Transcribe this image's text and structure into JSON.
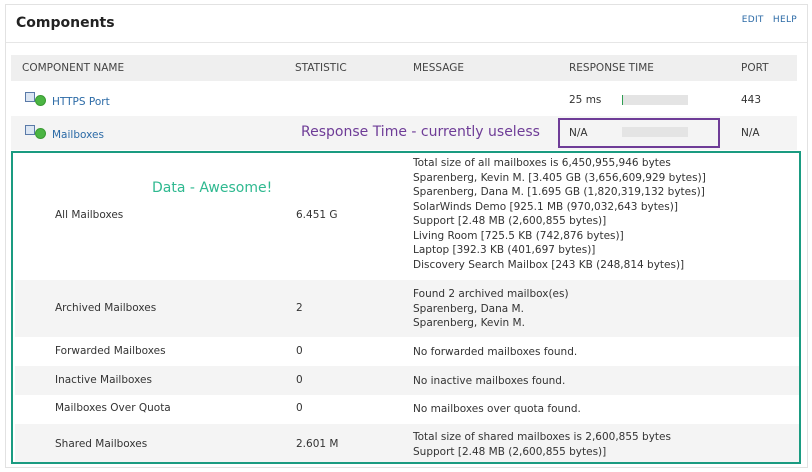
{
  "panel": {
    "title": "Components",
    "edit_label": "EDIT",
    "help_label": "HELP"
  },
  "columns": {
    "name": "COMPONENT NAME",
    "statistic": "STATISTIC",
    "message": "MESSAGE",
    "response_time": "RESPONSE TIME",
    "port": "PORT"
  },
  "components": [
    {
      "name": "HTTPS Port",
      "response_time": "25 ms",
      "response_bar_level": 0.02,
      "port": "443"
    },
    {
      "name": "Mailboxes",
      "response_time": "N/A",
      "response_bar_level": 0,
      "port": "N/A"
    }
  ],
  "annotations": {
    "purple": "Response Time - currently useless",
    "green": "Data - Awesome!",
    "purple_color": "#6e3c97",
    "green_color": "#1a9b81"
  },
  "statistics": [
    {
      "name": "All Mailboxes",
      "value": "6.451 G",
      "message": [
        "Total size of all mailboxes is 6,450,955,946 bytes",
        "Sparenberg, Kevin M. [3.405 GB (3,656,609,929 bytes)]",
        "Sparenberg, Dana M. [1.695 GB (1,820,319,132 bytes)]",
        "SolarWinds Demo [925.1 MB (970,032,643 bytes)]",
        "Support [2.48 MB (2,600,855 bytes)]",
        "Living Room [725.5 KB (742,876 bytes)]",
        "Laptop [392.3 KB (401,697 bytes)]",
        "Discovery Search Mailbox [243 KB (248,814 bytes)]"
      ]
    },
    {
      "name": "Archived Mailboxes",
      "value": "2",
      "message": [
        "Found 2 archived mailbox(es)",
        "Sparenberg, Dana M.",
        "Sparenberg, Kevin M."
      ]
    },
    {
      "name": "Forwarded Mailboxes",
      "value": "0",
      "message": [
        "No forwarded mailboxes found."
      ]
    },
    {
      "name": "Inactive Mailboxes",
      "value": "0",
      "message": [
        "No inactive mailboxes found."
      ]
    },
    {
      "name": "Mailboxes Over Quota",
      "value": "0",
      "message": [
        "No mailboxes over quota found."
      ]
    },
    {
      "name": "Shared Mailboxes",
      "value": "2.601 M",
      "message": [
        "Total size of shared mailboxes is 2,600,855 bytes",
        "Support [2.48 MB (2,600,855 bytes)]"
      ]
    }
  ],
  "colors": {
    "link": "#2b6aa6",
    "status_up": "#4bb543",
    "bar_fill": "#2e9e52",
    "header_bg": "#efefef"
  },
  "icons": {
    "component_status": "status-up-icon",
    "component_type": "monitor-icon"
  }
}
